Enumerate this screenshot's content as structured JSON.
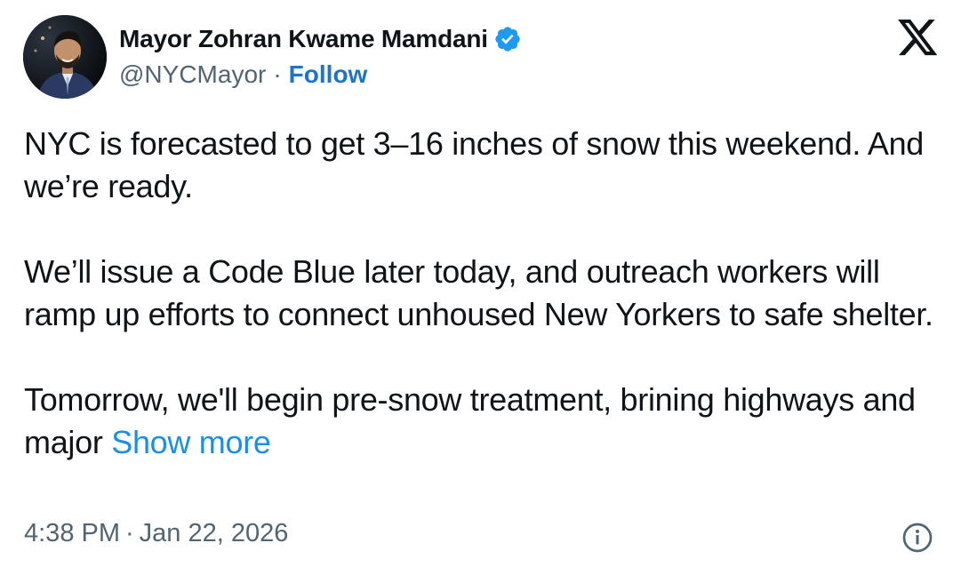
{
  "author": {
    "display_name": "Mayor Zohran Kwame Mamdani",
    "handle": "@NYCMayor",
    "separator": "·",
    "follow_label": "Follow",
    "verified_badge": "verified-badge-icon",
    "verified_color": "#1d9bf0"
  },
  "tweet": {
    "paragraphs": [
      "NYC is forecasted to get 3–16 inches of snow this weekend. And we’re ready.",
      "We’ll issue a Code Blue later today, and outreach workers will ramp up efforts to connect unhoused New Yorkers to safe shelter."
    ],
    "last_paragraph": "Tomorrow, we'll begin pre-snow treatment, brining highways and major ",
    "show_more_label": "Show more"
  },
  "meta": {
    "time": "4:38 PM",
    "separator": "·",
    "date": "Jan 22, 2026"
  },
  "icons": {
    "platform_logo": "x-logo-icon",
    "info": "info-icon"
  },
  "colors": {
    "text": "#0f1419",
    "secondary": "#536471",
    "link": "#1d8fe0",
    "background": "#ffffff"
  }
}
